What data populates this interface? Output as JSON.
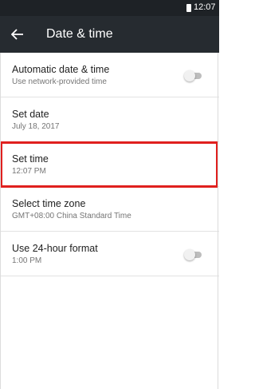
{
  "status_bar": {
    "time": "12:07",
    "battery_icon": "battery-icon"
  },
  "toolbar": {
    "title": "Date & time",
    "back_icon": "arrow-left-icon"
  },
  "settings": [
    {
      "title": "Automatic date & time",
      "subtitle": "Use network-provided time",
      "toggle": true,
      "enabled": false
    },
    {
      "title": "Set date",
      "subtitle": "July 18, 2017"
    },
    {
      "title": "Set time",
      "subtitle": "12:07 PM",
      "highlighted": true
    },
    {
      "title": "Select time zone",
      "subtitle": "GMT+08:00 China Standard Time"
    },
    {
      "title": "Use 24-hour format",
      "subtitle": "1:00 PM",
      "toggle": true,
      "enabled": false
    }
  ],
  "colors": {
    "toolbar": "#262b30",
    "status_bar": "#1e2226",
    "highlight": "#e0201e"
  }
}
